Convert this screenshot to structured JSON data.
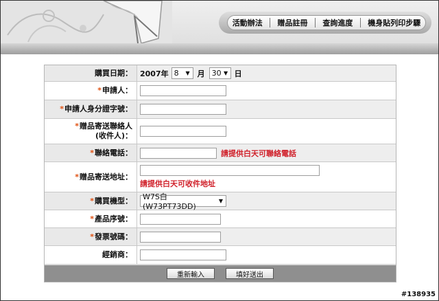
{
  "nav": {
    "items": [
      "活動辦法",
      "贈品註冊",
      "查詢進度",
      "機身貼列印步驟"
    ]
  },
  "form": {
    "purchase_date": {
      "label": "購買日期：",
      "year": "2007年",
      "month_value": "8",
      "month_unit": "月",
      "day_value": "30",
      "day_unit": "日"
    },
    "applicant": {
      "star": "*",
      "label": "申請人：",
      "value": ""
    },
    "applicant_id": {
      "star": "*",
      "label": "申請人身分證字號：",
      "value": ""
    },
    "gift_contact": {
      "star": "*",
      "label_line1": "贈品寄送聯絡人",
      "label_line2": "(收件人)：",
      "value": ""
    },
    "phone": {
      "star": "*",
      "label": "聯絡電話：",
      "value": "",
      "hint": "請提供白天可聯絡電話"
    },
    "address": {
      "star": "*",
      "label": "贈品寄送地址：",
      "value": "",
      "hint": "請提供白天可收件地址"
    },
    "model": {
      "star": "*",
      "label": "購買機型：",
      "selected": "W7S白 (W73PT73DD)"
    },
    "serial": {
      "star": "*",
      "label": "產品序號：",
      "value": ""
    },
    "invoice": {
      "star": "*",
      "label": "發票號碼：",
      "value": ""
    },
    "dealer": {
      "label": "經銷商：",
      "value": ""
    }
  },
  "buttons": {
    "reset": "重新輸入",
    "submit": "填好送出"
  },
  "watermark": "#138935",
  "colors": {
    "required_star": "#e05010",
    "warning_text": "#d0202a",
    "button_bar": "#8f8f8f"
  }
}
